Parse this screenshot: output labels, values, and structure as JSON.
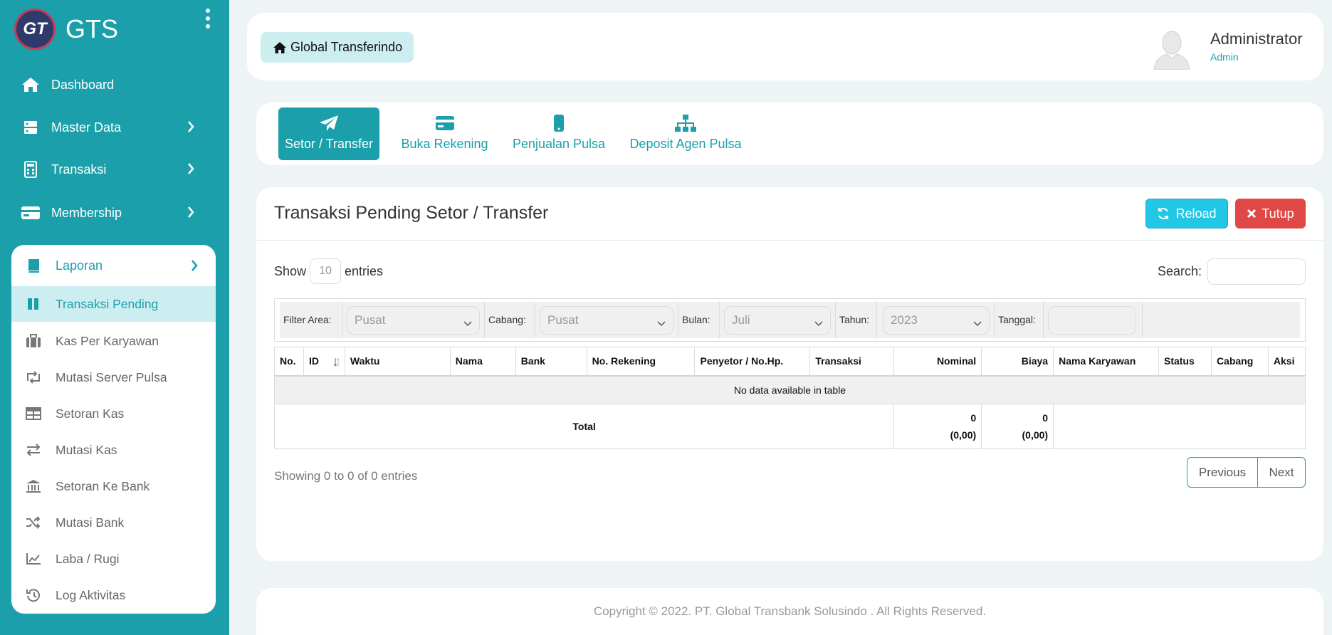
{
  "brand": {
    "logo_text": "GT",
    "name": "GTS"
  },
  "sidebar": {
    "items": [
      {
        "label": "Dashboard"
      },
      {
        "label": "Master Data"
      },
      {
        "label": "Transaksi"
      },
      {
        "label": "Membership"
      }
    ],
    "laporan": {
      "label": "Laporan",
      "items": [
        {
          "label": "Transaksi Pending"
        },
        {
          "label": "Kas Per Karyawan"
        },
        {
          "label": "Mutasi Server Pulsa"
        },
        {
          "label": "Setoran Kas"
        },
        {
          "label": "Mutasi Kas"
        },
        {
          "label": "Setoran Ke Bank"
        },
        {
          "label": "Mutasi Bank"
        },
        {
          "label": "Laba / Rugi"
        },
        {
          "label": "Log Aktivitas"
        }
      ]
    }
  },
  "header": {
    "home_label": "Global Transferindo",
    "user_name": "Administrator",
    "user_role": "Admin"
  },
  "tabs": [
    {
      "label": "Setor / Transfer",
      "icon": "paper-plane-icon"
    },
    {
      "label": "Buka Rekening",
      "icon": "credit-card-icon"
    },
    {
      "label": "Penjualan Pulsa",
      "icon": "mobile-icon"
    },
    {
      "label": "Deposit Agen Pulsa",
      "icon": "sitemap-icon"
    }
  ],
  "card": {
    "title": "Transaksi Pending Setor / Transfer",
    "reload_label": "Reload",
    "close_label": "Tutup",
    "show_label": "Show",
    "entries_value": "10",
    "entries_label": "entries",
    "search_label": "Search:",
    "search_value": ""
  },
  "filters": {
    "area_label": "Filter Area:",
    "area_value": "Pusat",
    "cabang_label": "Cabang:",
    "cabang_value": "Pusat",
    "bulan_label": "Bulan:",
    "bulan_value": "Juli",
    "tahun_label": "Tahun:",
    "tahun_value": "2023",
    "tanggal_label": "Tanggal:",
    "tanggal_value": ""
  },
  "table": {
    "columns": [
      "No.",
      "ID",
      "Waktu",
      "Nama",
      "Bank",
      "No. Rekening",
      "Penyetor / No.Hp.",
      "Transaksi",
      "Nominal",
      "Biaya",
      "Nama Karyawan",
      "Status",
      "Cabang",
      "Aksi"
    ],
    "empty_text": "No data available in table",
    "total_label": "Total",
    "total_nominal": "0",
    "total_nominal_sub": "(0,00)",
    "total_biaya": "0",
    "total_biaya_sub": "(0,00)"
  },
  "pagination": {
    "info": "Showing 0 to 0 of 0 entries",
    "previous": "Previous",
    "next": "Next"
  },
  "footer": {
    "text": "Copyright © 2022. PT. Global Transbank Solusindo . All Rights Reserved."
  },
  "colors": {
    "primary": "#1a9fab",
    "reload": "#22c7e6",
    "close": "#e04848",
    "background": "#eef4f6"
  }
}
